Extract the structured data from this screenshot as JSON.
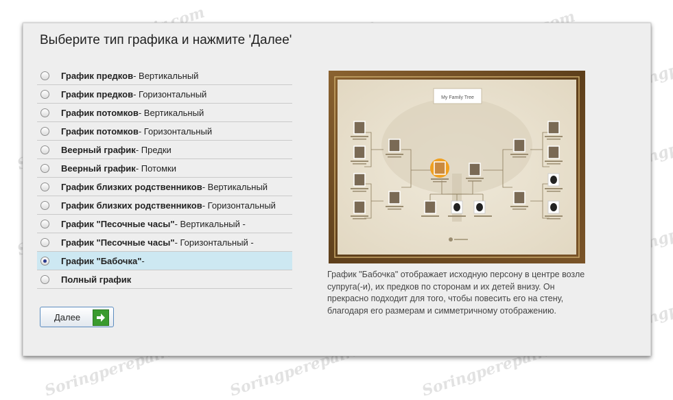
{
  "dialog": {
    "title": "Выберите тип графика и нажмите 'Далее'"
  },
  "chart_types": [
    {
      "name": "График предков",
      "variant": " - Вертикальный",
      "selected": false
    },
    {
      "name": "График предков",
      "variant": " - Горизонтальный",
      "selected": false
    },
    {
      "name": "График потомков",
      "variant": " - Вертикальный",
      "selected": false
    },
    {
      "name": "График потомков",
      "variant": " - Горизонтальный",
      "selected": false
    },
    {
      "name": "Веерный график",
      "variant": " - Предки",
      "selected": false
    },
    {
      "name": "Веерный график",
      "variant": " - Потомки",
      "selected": false
    },
    {
      "name": "График близких родственников",
      "variant": " - Вертикальный",
      "selected": false
    },
    {
      "name": "График близких родственников",
      "variant": " - Горизонтальный",
      "selected": false
    },
    {
      "name": "График \"Песочные часы\"",
      "variant": " - Вертикальный -",
      "selected": false
    },
    {
      "name": "График \"Песочные часы\"",
      "variant": " - Горизонтальный -",
      "selected": false
    },
    {
      "name": "График \"Бабочка\"",
      "variant": " -",
      "selected": true
    },
    {
      "name": "Полный график",
      "variant": "",
      "selected": false
    }
  ],
  "next_button": {
    "label": "Далее"
  },
  "preview": {
    "chart_title": "My Family Tree"
  },
  "description": "График \"Бабочка\" отображает исходную персону в центре возле супруга(-и), их предков по сторонам и их детей внизу. Он прекрасно подходит для того, чтобы повесить его на стену, благодаря его размерам и симметричному отображению.",
  "watermark": "Soringperepair.com",
  "colors": {
    "selected_row": "#cde8f2",
    "frame_wood": "#6b4a22",
    "arrow_green": "#3a9b2e",
    "root_highlight": "#f0a020"
  }
}
